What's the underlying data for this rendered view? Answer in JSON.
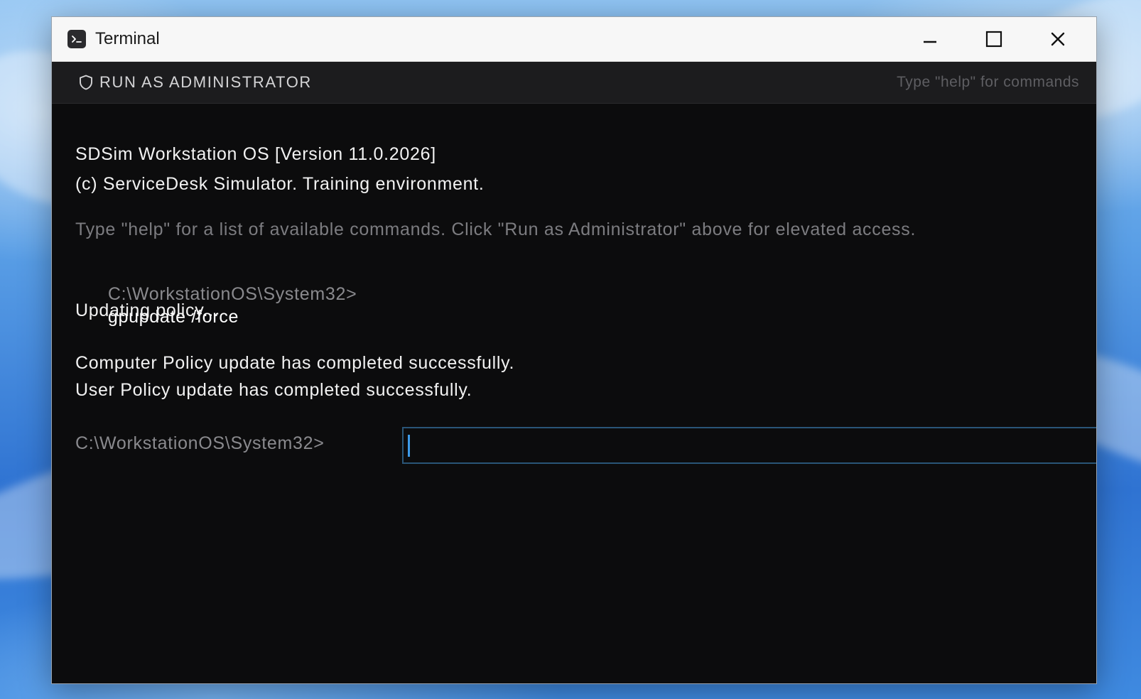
{
  "window": {
    "title": "Terminal",
    "icons": {
      "app": "terminal-icon",
      "minimize": "minimize-icon",
      "maximize": "maximize-icon",
      "close": "close-icon"
    }
  },
  "toolbar": {
    "admin_label": "RUN AS ADMINISTRATOR",
    "admin_icon": "shield-icon",
    "hint": "Type \"help\" for commands"
  },
  "console": {
    "banner_line1": "SDSim Workstation OS [Version 11.0.2026]",
    "banner_line2": "(c) ServiceDesk Simulator. Training environment.",
    "help_text": "Type \"help\" for a list of available commands. Click \"Run as Administrator\" above for elevated access.",
    "history": [
      {
        "prompt": "C:\\WorkstationOS\\System32>",
        "command": "gpupdate /force"
      }
    ],
    "output": [
      "Updating policy...",
      "Computer Policy update has completed successfully.",
      "User Policy update has completed successfully."
    ],
    "current_prompt": "C:\\WorkstationOS\\System32>",
    "current_input": ""
  },
  "colors": {
    "console_bg": "#0c0c0d",
    "toolbar_bg": "#1c1c1e",
    "titlebar_bg": "#f7f7f7",
    "caret": "#3d9be9",
    "input_border": "#2a5577"
  }
}
